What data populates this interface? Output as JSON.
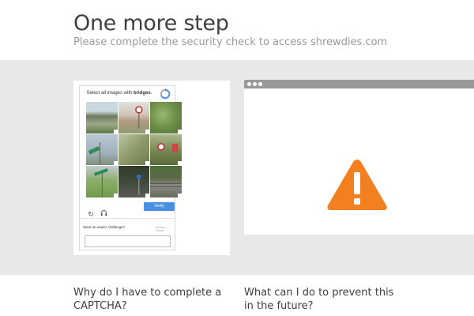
{
  "header": {
    "title": "One more step",
    "subtitle": "Please complete the security check to access shrewdies.com"
  },
  "captcha": {
    "instruction_prefix": "Select all images with",
    "instruction_target": "bridges",
    "instruction_suffix": ".",
    "logo_icon": "recaptcha-icon",
    "reload_icon": "reload-icon",
    "audio_icon": "headphones-icon",
    "verify_label": "Verify",
    "easier_link": "Want an easier challenge?",
    "privacy_terms": "Privacy • Terms",
    "response_value": "",
    "accent_color": "#4a90e2",
    "tiles": [
      {
        "desc": "road bridge",
        "color": "#8aa870"
      },
      {
        "desc": "building with sign",
        "color": "#b9a690"
      },
      {
        "desc": "trees",
        "color": "#6e8f4a"
      },
      {
        "desc": "street sign",
        "color": "#a7b6bf"
      },
      {
        "desc": "green road sign",
        "color": "#8f9a6a"
      },
      {
        "desc": "traffic sign",
        "color": "#7a8a55"
      },
      {
        "desc": "green sign grass",
        "color": "#6f9a4a"
      },
      {
        "desc": "dark road",
        "color": "#3f4a3a"
      },
      {
        "desc": "road fence",
        "color": "#5d6a4a"
      }
    ]
  },
  "browser_graphic": {
    "warning_icon": "warning-triangle-icon",
    "warning_color": "#f38020"
  },
  "faq": {
    "q1": "Why do I have to complete a CAPTCHA?",
    "q2": "What can I do to prevent this in the future?"
  }
}
